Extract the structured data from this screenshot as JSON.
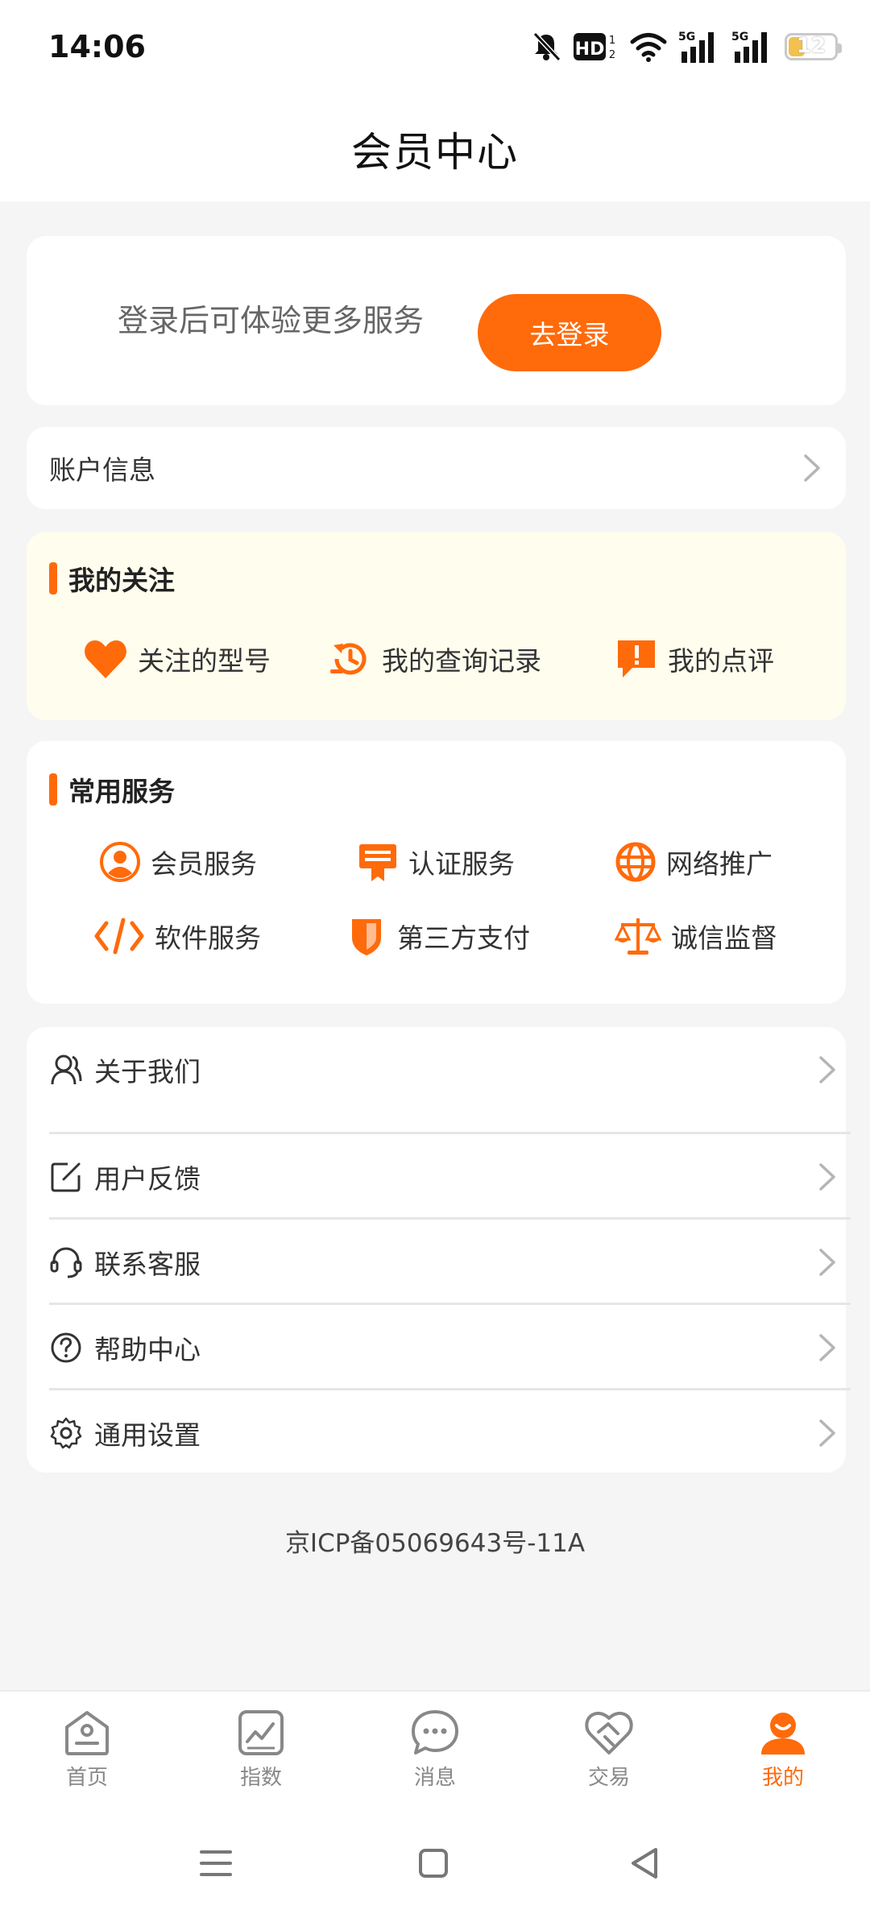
{
  "status_bar": {
    "time": "14:06",
    "icons": [
      "bell-off-icon",
      "hd-icon",
      "wifi-icon",
      "signal-5g-icon",
      "signal-5g-icon"
    ],
    "battery_level": "12"
  },
  "header": {
    "title": "会员中心"
  },
  "login": {
    "prompt": "登录后可体验更多服务",
    "button_label": "去登录"
  },
  "account": {
    "label": "账户信息"
  },
  "follow": {
    "title": "我的关注",
    "items": [
      {
        "label": "关注的型号",
        "icon": "heart-icon"
      },
      {
        "label": "我的查询记录",
        "icon": "history-icon"
      },
      {
        "label": "我的点评",
        "icon": "comment-alert-icon"
      }
    ]
  },
  "services": {
    "title": "常用服务",
    "items": [
      {
        "label": "会员服务",
        "icon": "user-circle-icon"
      },
      {
        "label": "认证服务",
        "icon": "certificate-icon"
      },
      {
        "label": "网络推广",
        "icon": "globe-icon"
      },
      {
        "label": "软件服务",
        "icon": "code-icon"
      },
      {
        "label": "第三方支付",
        "icon": "shield-icon"
      },
      {
        "label": "诚信监督",
        "icon": "scale-icon"
      }
    ]
  },
  "menu": {
    "items": [
      {
        "label": "关于我们",
        "icon": "user-icon"
      },
      {
        "label": "用户反馈",
        "icon": "edit-icon"
      },
      {
        "label": "联系客服",
        "icon": "headset-icon"
      },
      {
        "label": "帮助中心",
        "icon": "help-icon"
      },
      {
        "label": "通用设置",
        "icon": "gear-icon"
      }
    ]
  },
  "footer": {
    "icp": "京ICP备05069643号-11A"
  },
  "tabs": [
    {
      "label": "首页",
      "icon": "home-icon",
      "active": false
    },
    {
      "label": "指数",
      "icon": "chart-icon",
      "active": false
    },
    {
      "label": "消息",
      "icon": "message-icon",
      "active": false
    },
    {
      "label": "交易",
      "icon": "handshake-icon",
      "active": false
    },
    {
      "label": "我的",
      "icon": "profile-icon",
      "active": true
    }
  ],
  "colors": {
    "accent": "#ff6a0a",
    "follow_bg": "#fffdee",
    "page_bg": "#f5f5f5"
  }
}
